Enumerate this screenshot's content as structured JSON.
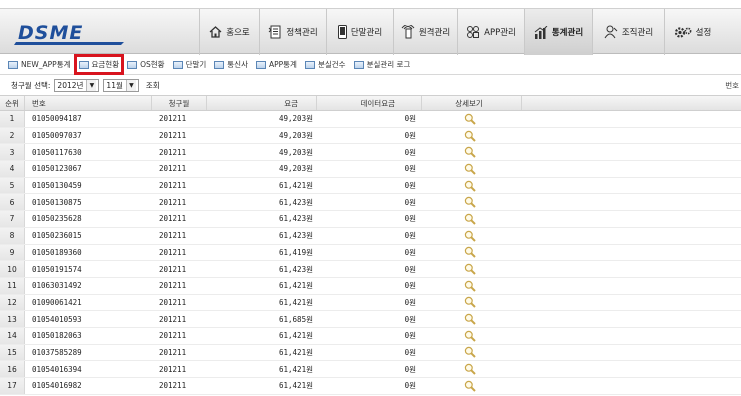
{
  "logo": {
    "text": "DSME"
  },
  "nav": [
    {
      "label": "홈으로",
      "icon": "home-icon"
    },
    {
      "label": "정책관리",
      "icon": "policy-icon"
    },
    {
      "label": "단말관리",
      "icon": "device-icon"
    },
    {
      "label": "원격관리",
      "icon": "remote-icon"
    },
    {
      "label": "APP관리",
      "icon": "app-icon"
    },
    {
      "label": "통계관리",
      "icon": "stats-icon",
      "active": true
    },
    {
      "label": "조직관리",
      "icon": "org-icon"
    },
    {
      "label": "설정",
      "icon": "settings-icon"
    }
  ],
  "subnav": [
    {
      "label": "NEW_APP통계"
    },
    {
      "label": "요금현황",
      "highlighted": true
    },
    {
      "label": "OS현황"
    },
    {
      "label": "단말기"
    },
    {
      "label": "통신사"
    },
    {
      "label": "APP통계"
    },
    {
      "label": "분실건수"
    },
    {
      "label": "분실관리 로그"
    }
  ],
  "filter": {
    "label": "청구월 선택:",
    "year": "2012년",
    "month": "11월",
    "lookup": "조회",
    "right_hint": "번호"
  },
  "table": {
    "headers": {
      "idx": "순위",
      "number": "번호",
      "period": "청구월",
      "fee": "요금",
      "data_fee": "데이터요금",
      "detail": "상세보기"
    },
    "rows": [
      {
        "idx": "1",
        "number": "01050094187",
        "period": "201211",
        "fee": "49,203원",
        "data_fee": "0원"
      },
      {
        "idx": "2",
        "number": "01050097037",
        "period": "201211",
        "fee": "49,203원",
        "data_fee": "0원"
      },
      {
        "idx": "3",
        "number": "01050117630",
        "period": "201211",
        "fee": "49,203원",
        "data_fee": "0원"
      },
      {
        "idx": "4",
        "number": "01050123067",
        "period": "201211",
        "fee": "49,203원",
        "data_fee": "0원"
      },
      {
        "idx": "5",
        "number": "01050130459",
        "period": "201211",
        "fee": "61,421원",
        "data_fee": "0원"
      },
      {
        "idx": "6",
        "number": "01050130875",
        "period": "201211",
        "fee": "61,423원",
        "data_fee": "0원"
      },
      {
        "idx": "7",
        "number": "01050235628",
        "period": "201211",
        "fee": "61,423원",
        "data_fee": "0원"
      },
      {
        "idx": "8",
        "number": "01050236015",
        "period": "201211",
        "fee": "61,423원",
        "data_fee": "0원"
      },
      {
        "idx": "9",
        "number": "01050189360",
        "period": "201211",
        "fee": "61,419원",
        "data_fee": "0원"
      },
      {
        "idx": "10",
        "number": "01050191574",
        "period": "201211",
        "fee": "61,423원",
        "data_fee": "0원"
      },
      {
        "idx": "11",
        "number": "01063031492",
        "period": "201211",
        "fee": "61,421원",
        "data_fee": "0원"
      },
      {
        "idx": "12",
        "number": "01090061421",
        "period": "201211",
        "fee": "61,421원",
        "data_fee": "0원"
      },
      {
        "idx": "13",
        "number": "01054010593",
        "period": "201211",
        "fee": "61,685원",
        "data_fee": "0원"
      },
      {
        "idx": "14",
        "number": "01050182063",
        "period": "201211",
        "fee": "61,421원",
        "data_fee": "0원"
      },
      {
        "idx": "15",
        "number": "01037585289",
        "period": "201211",
        "fee": "61,421원",
        "data_fee": "0원"
      },
      {
        "idx": "16",
        "number": "01054016394",
        "period": "201211",
        "fee": "61,421원",
        "data_fee": "0원"
      },
      {
        "idx": "17",
        "number": "01054016982",
        "period": "201211",
        "fee": "61,421원",
        "data_fee": "0원"
      }
    ]
  },
  "colors": {
    "highlight": "#d8141e",
    "logo": "#1f4f9b",
    "magnifier": "#c9a64a"
  }
}
